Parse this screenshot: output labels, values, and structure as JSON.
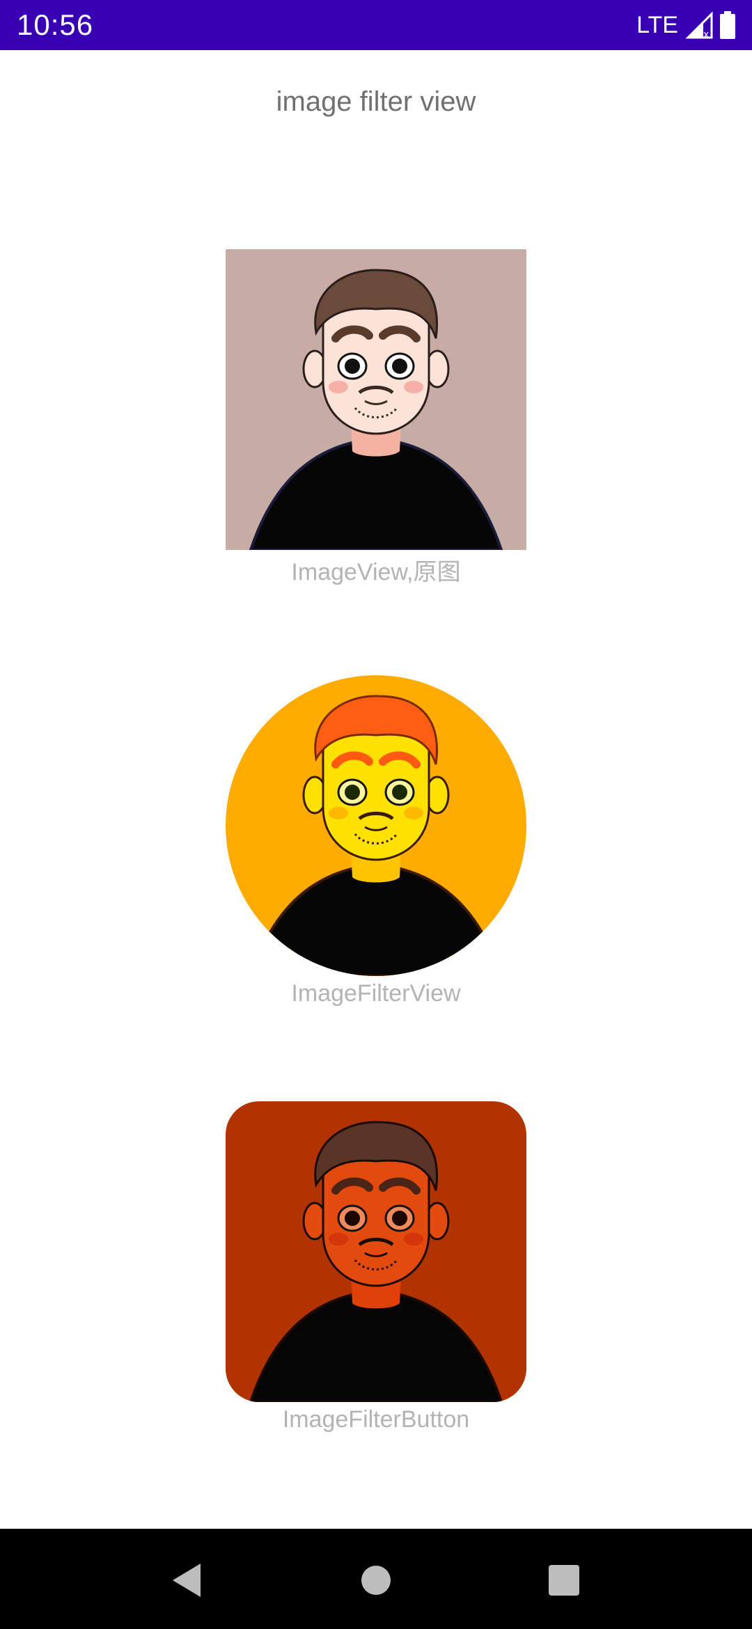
{
  "status_bar": {
    "time": "10:56",
    "network": "LTE",
    "background_color": "#3700b3",
    "icons": [
      "signal-icon",
      "battery-icon"
    ]
  },
  "page": {
    "title": "image filter view"
  },
  "images": [
    {
      "caption": "ImageView,原图",
      "shape": "square",
      "background": "#c6aca5",
      "skin": "#fbe3d8",
      "hair": "#6a4a3a"
    },
    {
      "caption": "ImageFilterView",
      "shape": "circle",
      "background": "#ffab00",
      "skin": "#ffe100",
      "hair": "#ff5d12"
    },
    {
      "caption": "ImageFilterButton",
      "shape": "rounded",
      "background": "#b13300",
      "skin": "#e34a0e",
      "hair": "#5a3426"
    }
  ],
  "nav_bar": {
    "buttons": [
      "back-icon",
      "home-icon",
      "recents-icon"
    ]
  }
}
